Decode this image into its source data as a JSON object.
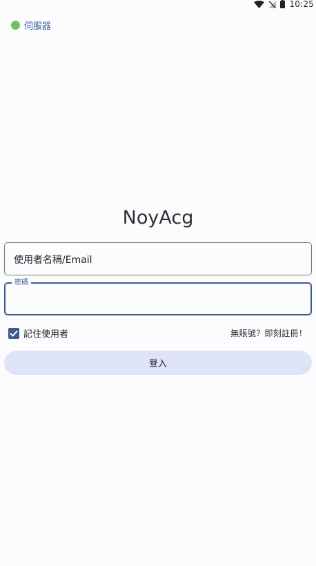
{
  "status_bar": {
    "time": "10:25",
    "icons": [
      "wifi-icon",
      "no-signal-icon",
      "battery-icon"
    ]
  },
  "server": {
    "label": "伺服器",
    "status_color": "#6cc45f"
  },
  "app": {
    "title": "NoyAcg"
  },
  "login_form": {
    "username_placeholder": "使用者名稱/Email",
    "password_label": "密碼",
    "password_value": "",
    "remember_label": "記住使用者",
    "remember_checked": true,
    "register_link": "無賬號？即刻註冊！",
    "submit_label": "登入"
  },
  "colors": {
    "accent": "#3e5b8c",
    "button_bg": "#dfe3f8",
    "background": "#fcfbfe"
  }
}
